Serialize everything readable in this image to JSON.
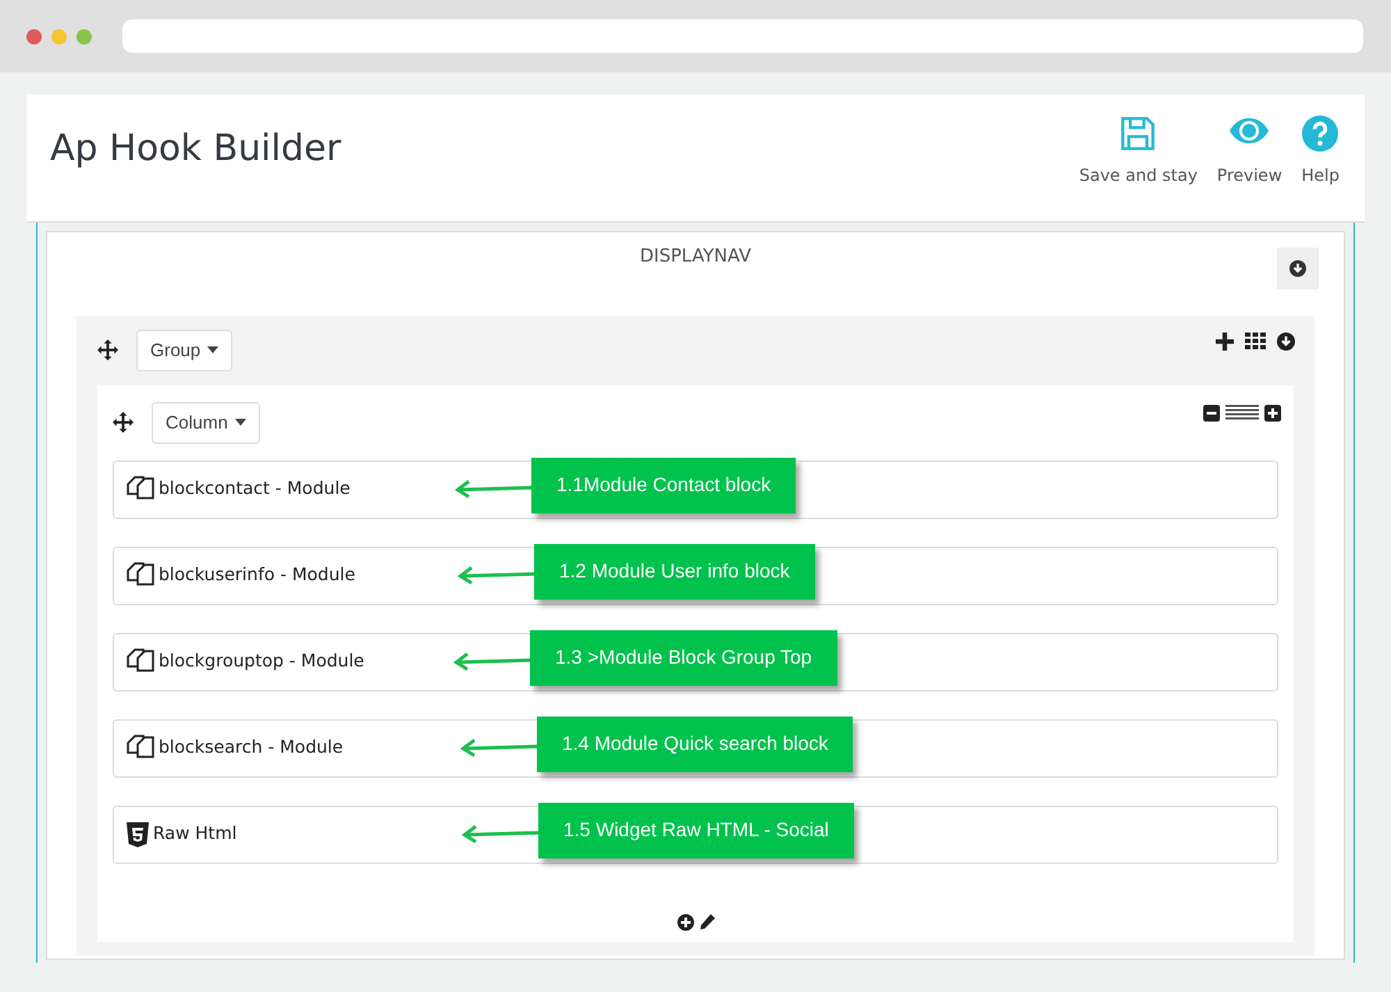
{
  "header": {
    "title": "Ap Hook Builder",
    "actions": [
      {
        "kind": "save",
        "label": "Save and stay"
      },
      {
        "kind": "preview",
        "label": "Preview"
      },
      {
        "kind": "help",
        "label": "Help"
      }
    ]
  },
  "hook": {
    "title": "DISPLAYNAV"
  },
  "group": {
    "label": "Group"
  },
  "column": {
    "label": "Column"
  },
  "items": [
    {
      "kind": "module",
      "label": "blockcontact - Module",
      "callout": "1.1Module Contact block"
    },
    {
      "kind": "module",
      "label": "blockuserinfo - Module",
      "callout": "1.2 Module User info block"
    },
    {
      "kind": "module",
      "label": "blockgrouptop - Module",
      "callout": "1.3 >Module Block Group Top"
    },
    {
      "kind": "module",
      "label": "blocksearch - Module",
      "callout": "1.4 Module Quick search block"
    },
    {
      "kind": "widget",
      "label": "Raw Html",
      "callout": "1.5 Widget Raw HTML - Social"
    }
  ]
}
